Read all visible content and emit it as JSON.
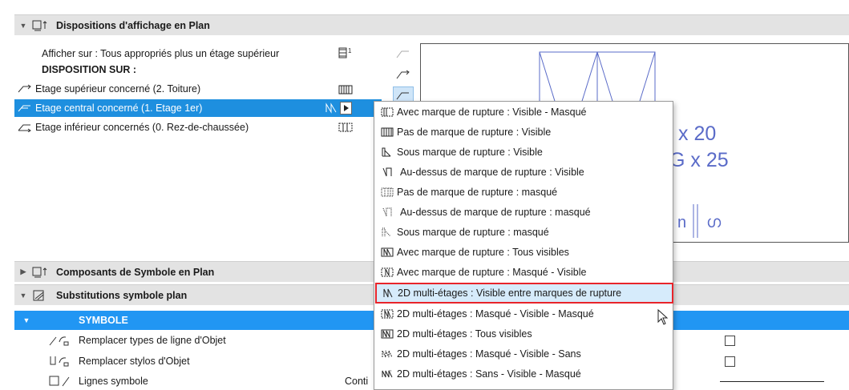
{
  "sections": {
    "plan_display": "Dispositions d'affichage en Plan",
    "symbol_components": "Composants de Symbole en Plan",
    "symbol_substitutions": "Substitutions symbole plan"
  },
  "plan_display": {
    "show_on": "Afficher sur : Tous appropriés plus un étage supérieur",
    "disposition_label": "DISPOSITION SUR :",
    "stories": [
      {
        "label": "Etage supérieur concerné (2. Toiture)"
      },
      {
        "label": "Etage central concerné (1. Etage 1er)"
      },
      {
        "label": "Etage inférieur concernés (0. Rez-de-chaussée)"
      }
    ]
  },
  "preview": {
    "text_line1": "R x 20",
    "text_line2": "G x 25",
    "text_bottom": "n",
    "text_bottom2": "ഗ"
  },
  "dropdown": {
    "items": [
      "Avec marque de rupture : Visible - Masqué",
      "Pas de marque de rupture : Visible",
      "Sous marque de rupture : Visible",
      "Au-dessus de marque de rupture : Visible",
      "Pas de marque de rupture : masqué",
      "Au-dessus de marque de rupture : masqué",
      "Sous marque de rupture : masqué",
      "Avec marque de rupture : Tous visibles",
      "Avec marque de rupture : Masqué - Visible",
      "2D multi-étages : Visible entre marques de rupture",
      "2D multi-étages : Masqué - Visible - Masqué",
      "2D multi-étages : Tous visibles",
      "2D multi-étages : Masqué - Visible - Sans",
      "2D multi-étages : Sans - Visible - Masqué"
    ],
    "highlighted_index": 9
  },
  "symbol": {
    "header": "SYMBOLE",
    "rows": [
      {
        "label": "Remplacer types de ligne d'Objet"
      },
      {
        "label": "Remplacer stylos d'Objet"
      },
      {
        "label": "Lignes symbole",
        "value": "Conti"
      }
    ]
  },
  "colors": {
    "selection": "#1e8fdf",
    "symbol_header": "#2196f3",
    "highlight_border": "#e8242a"
  }
}
